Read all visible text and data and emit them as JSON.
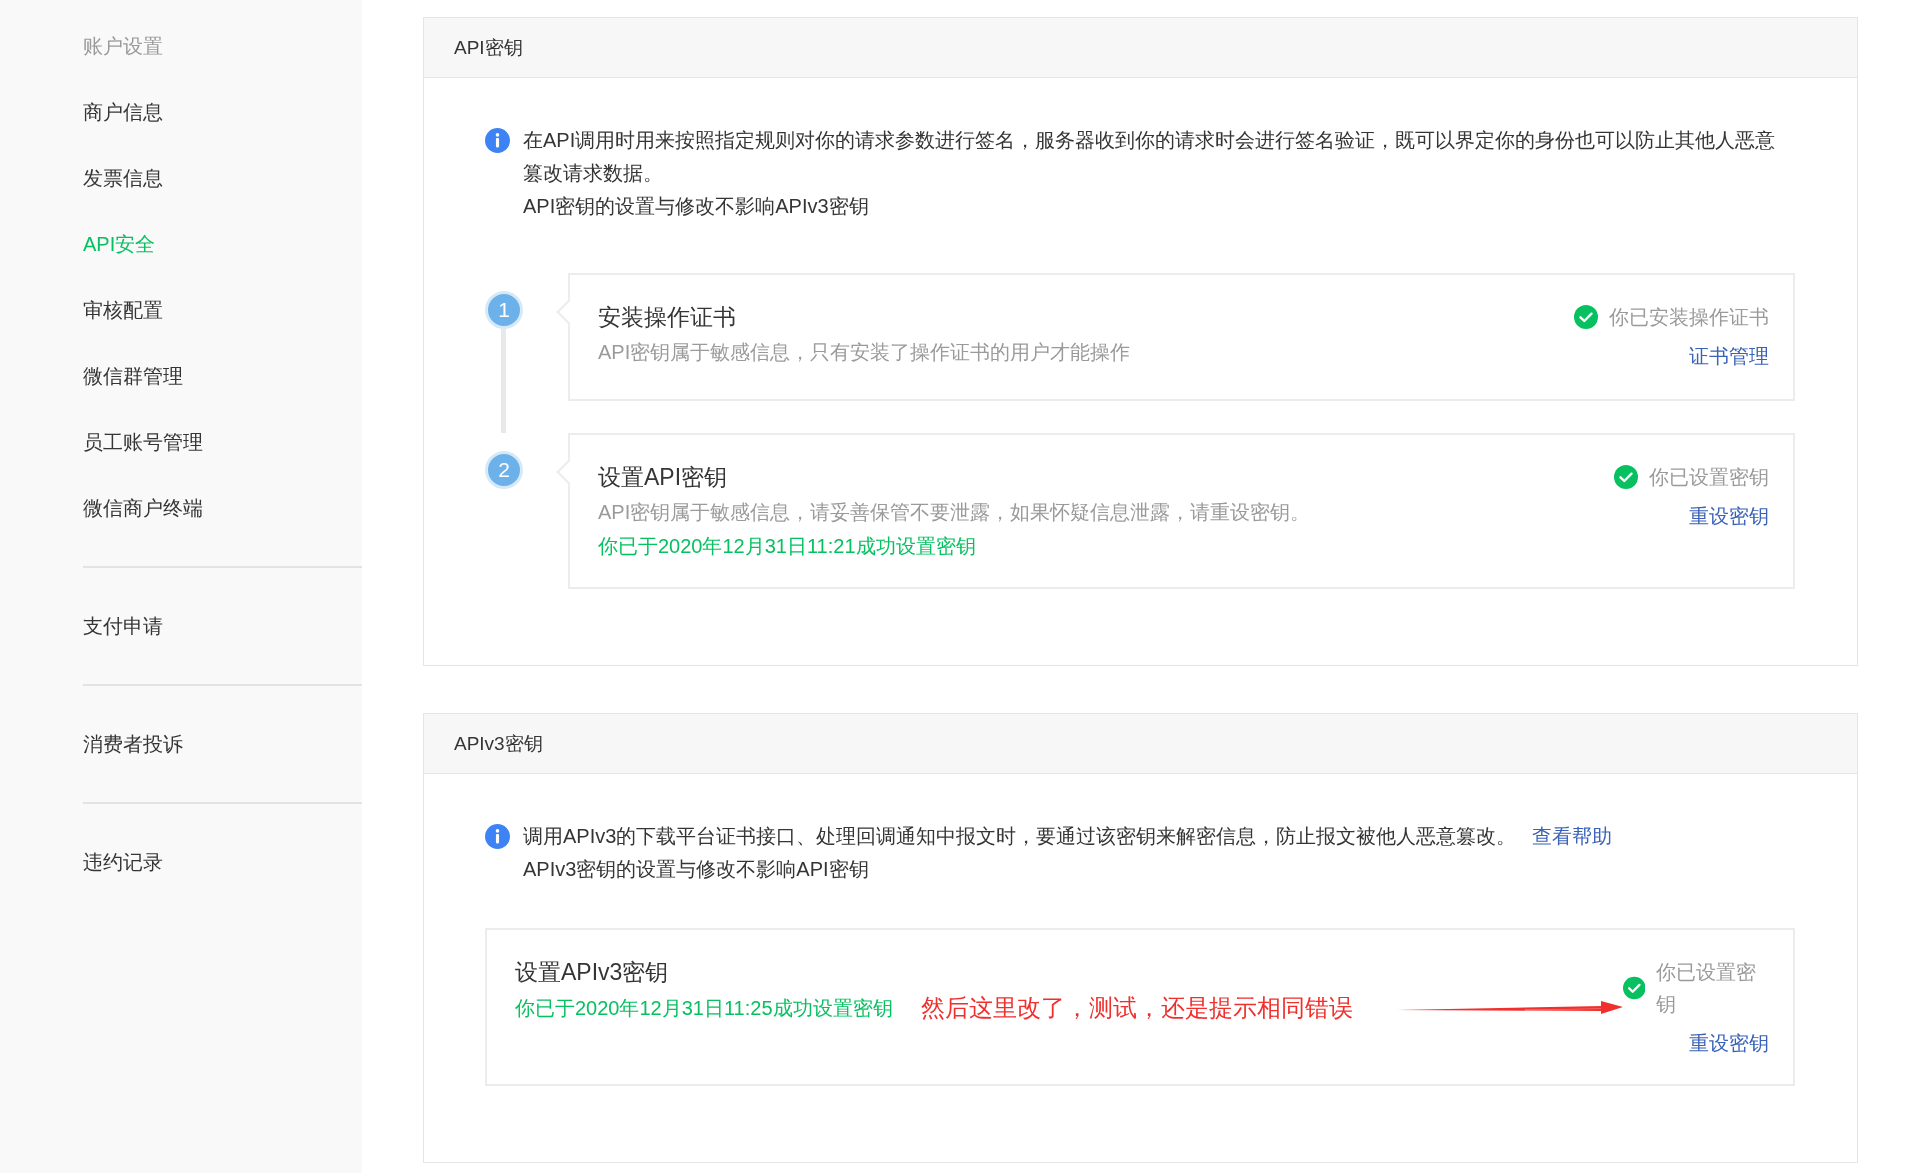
{
  "sidebar": {
    "heading": "账户设置",
    "sections": [
      {
        "items": [
          {
            "label": "商户信息",
            "selected": false
          },
          {
            "label": "发票信息",
            "selected": false
          },
          {
            "label": "API安全",
            "selected": true
          },
          {
            "label": "审核配置",
            "selected": false
          },
          {
            "label": "微信群管理",
            "selected": false
          },
          {
            "label": "员工账号管理",
            "selected": false
          },
          {
            "label": "微信商户终端",
            "selected": false
          }
        ]
      },
      {
        "items": [
          {
            "label": "支付申请",
            "selected": false
          }
        ]
      },
      {
        "items": [
          {
            "label": "消费者投诉",
            "selected": false
          }
        ]
      },
      {
        "items": [
          {
            "label": "违约记录",
            "selected": false
          }
        ]
      }
    ]
  },
  "panels": [
    {
      "title": "API密钥",
      "info": {
        "text": "在API调用时用来按照指定规则对你的请求参数进行签名，服务器收到你的请求时会进行签名验证，既可以界定你的身份也可以防止其他人恶意篡改请求数据。",
        "note": "API密钥的设置与修改不影响APIv3密钥"
      },
      "cards": [
        {
          "number": "1",
          "title": "安装操作证书",
          "description": "API密钥属于敏感信息，只有安装了操作证书的用户才能操作",
          "status": "你已安装操作证书",
          "action": "证书管理"
        },
        {
          "number": "2",
          "title": "设置API密钥",
          "description": "API密钥属于敏感信息，请妥善保管不要泄露，如果怀疑信息泄露，请重设密钥。",
          "success": "你已于2020年12月31日11:21成功设置密钥",
          "status": "你已设置密钥",
          "action": "重设密钥"
        }
      ]
    },
    {
      "title": "APIv3密钥",
      "info": {
        "text": "调用APIv3的下载平台证书接口、处理回调通知中报文时，要通过该密钥来解密信息，防止报文被他人恶意篡改。",
        "link": "查看帮助",
        "note": "APIv3密钥的设置与修改不影响API密钥"
      },
      "cards": [
        {
          "title": "设置APIv3密钥",
          "success": "你已于2020年12月31日11:25成功设置密钥",
          "annotation": "然后这里改了，测试，还是提示相同错误",
          "status": "你已设置密钥",
          "action": "重设密钥"
        }
      ]
    }
  ]
}
